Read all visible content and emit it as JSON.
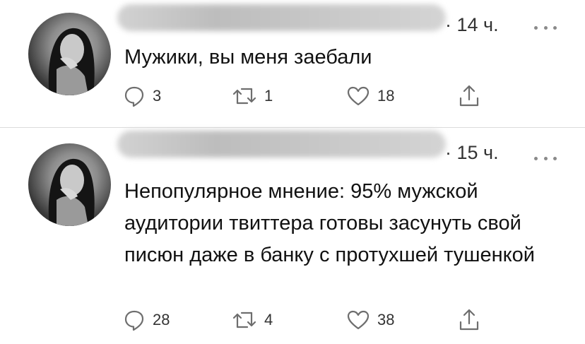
{
  "tweets": [
    {
      "time": "· 14 ч.",
      "text": "Мужики, вы меня заебали",
      "replies": "3",
      "retweets": "1",
      "likes": "18"
    },
    {
      "time": "· 15 ч.",
      "text": "Непопулярное мнение: 95% мужской аудитории твиттера готовы засунуть свой писюн даже в банку с протухшей тушенкой",
      "replies": "28",
      "retweets": "4",
      "likes": "38"
    }
  ],
  "colors": {
    "icon": "#6e6e6e",
    "text": "#111111",
    "divider": "#dcdcdc"
  },
  "icons": [
    "reply-icon",
    "retweet-icon",
    "like-icon",
    "share-icon",
    "more-icon"
  ]
}
